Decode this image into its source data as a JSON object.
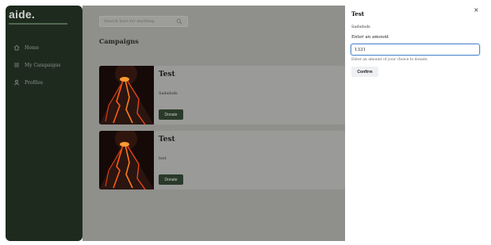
{
  "sidebar": {
    "logo": "aide.",
    "items": [
      {
        "label": "Home",
        "icon": "home-icon"
      },
      {
        "label": "My Campaigns",
        "icon": "list-icon"
      },
      {
        "label": "Profiles",
        "icon": "user-icon"
      }
    ]
  },
  "search": {
    "placeholder": "Search here for anything",
    "icon": "search-icon"
  },
  "main": {
    "title": "Campaigns"
  },
  "campaigns": [
    {
      "title": "Test",
      "description": "Sadsdsds",
      "button": "Donate"
    },
    {
      "title": "Test",
      "description": "test",
      "button": "Donate"
    }
  ],
  "panel": {
    "title": "Test",
    "close": "×",
    "description": "Sadsdsds",
    "amount_label": "Enter an amount",
    "amount_value": "1331",
    "hint": "Enter an amount of your choice to donate.",
    "confirm": "Confirm"
  },
  "colors": {
    "sidebar": "#1f2a1f",
    "accent": "#2a3a2a",
    "input_focus": "#5a8fd1",
    "overlay": "#8f8f8c"
  }
}
